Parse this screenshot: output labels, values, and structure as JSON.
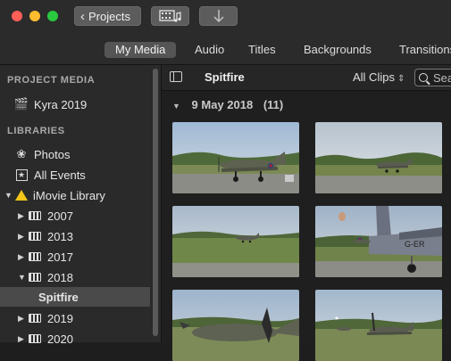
{
  "toolbar": {
    "projects_label": "Projects",
    "media_icon": "media-browser-icon",
    "import_icon": "import-arrow-icon"
  },
  "tabs": [
    {
      "label": "My Media",
      "active": true
    },
    {
      "label": "Audio",
      "active": false
    },
    {
      "label": "Titles",
      "active": false
    },
    {
      "label": "Backgrounds",
      "active": false
    },
    {
      "label": "Transitions",
      "active": false
    }
  ],
  "sidebar": {
    "project_media_heading": "PROJECT MEDIA",
    "project_item": "Kyra 2019",
    "libraries_heading": "LIBRARIES",
    "photos": "Photos",
    "all_events": "All Events",
    "library": "iMovie Library",
    "events": [
      "2007",
      "2013",
      "2017",
      "2018"
    ],
    "selected_event": "Spitfire",
    "events_after": [
      "2019",
      "2020"
    ]
  },
  "browser": {
    "title": "Spitfire",
    "filter": "All Clips",
    "search_placeholder": "Search",
    "date_group": "9 May 2018",
    "clip_count": "(11)"
  },
  "colors": {
    "accent_warning": "#f5c518",
    "selected_row": "#4a4a4a",
    "active_tab": "#555555"
  }
}
